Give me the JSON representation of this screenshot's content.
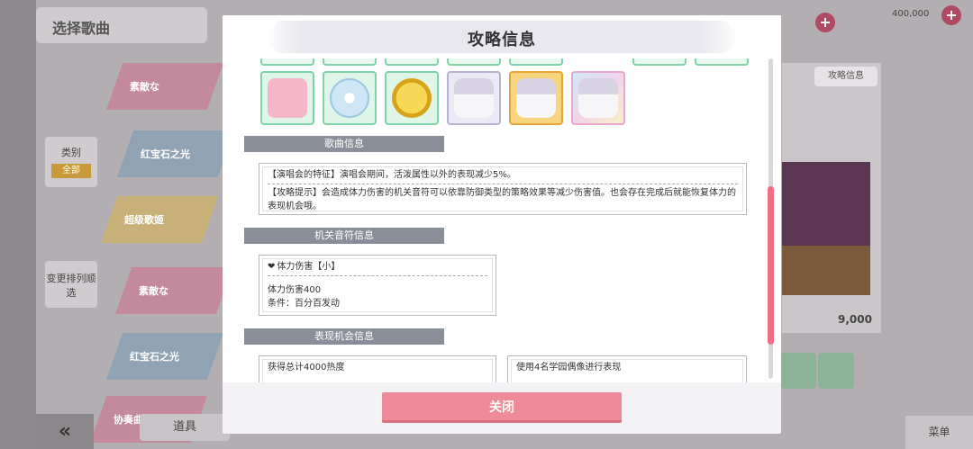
{
  "background": {
    "header_title": "选择歌曲",
    "songs": [
      {
        "label": "素敵な"
      },
      {
        "label": "红宝石之光"
      },
      {
        "label": "超级歌姬"
      },
      {
        "label": "素敵な"
      },
      {
        "label": "红宝石之光"
      },
      {
        "label": "协奏曲"
      }
    ],
    "filter_button": {
      "label": "类别",
      "sub": "全部"
    },
    "sort_button": {
      "label": "变更排列顺选"
    },
    "tool_button": "道具",
    "strategy_button": "攻略信息",
    "score": "9,000",
    "menu_button": "菜单",
    "coins": "400,000",
    "back_icon": "double-chevron-left-icon"
  },
  "modal": {
    "title": "攻略信息",
    "song_info": {
      "label": "歌曲信息",
      "feature": "【演唱会的特征】演唱会期间，活泼属性以外的表现减少5%。",
      "tip": "【攻略提示】会造成体力伤害的机关音符可以依靠防御类型的策略效果等减少伤害值。也会存在完成后就能恢复体力的表现机会哦。"
    },
    "gimmick_info": {
      "label": "机关音符信息",
      "name": "体力伤害【小】",
      "damage": "体力伤害400",
      "condition": "条件：百分百发动"
    },
    "chance_info": {
      "label": "表现机会信息",
      "chance1": "获得总计4000热度",
      "chance2": "使用4名学园偶像进行表现"
    },
    "close_button": "关闭"
  },
  "colors": {
    "accent_pink": "#ee8b98",
    "scroll_thumb": "#ee6e86",
    "section_label_bg": "#8a8e99"
  }
}
